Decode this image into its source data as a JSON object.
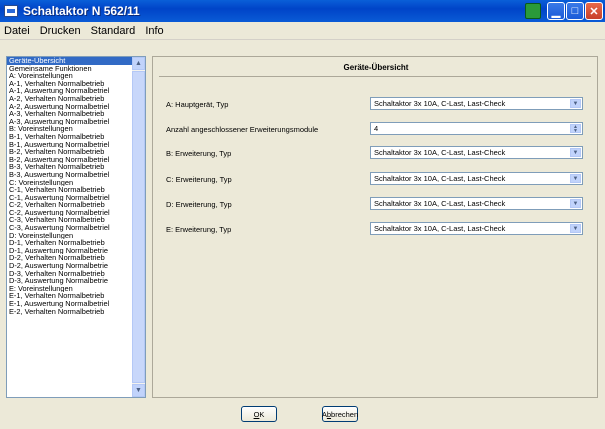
{
  "window": {
    "title": "Schaltaktor N 562/11"
  },
  "menu": [
    "Datei",
    "Drucken",
    "Standard",
    "Info"
  ],
  "nav": {
    "items": [
      "Geräte-Übersicht",
      "Gemeinsame Funktionen",
      "A: Voreinstellungen",
      "A-1, Verhalten Normalbetrieb",
      "A-1, Auswertung Normalbetriel",
      "A-2, Verhalten Normalbetrieb",
      "A-2, Auswertung Normalbetriel",
      "A-3, Verhalten Normalbetrieb",
      "A-3, Auswertung Normalbetriel",
      "B: Voreinstellungen",
      "B-1, Verhalten Normalbetrieb",
      "B-1, Auswertung Normalbetriel",
      "B-2, Verhalten Normalbetrieb",
      "B-2, Auswertung Normalbetriel",
      "B-3, Verhalten Normalbetrieb",
      "B-3, Auswertung Normalbetriel",
      "C: Voreinstellungen",
      "C-1, Verhalten Normalbetrieb",
      "C-1, Auswertung Normalbetriel",
      "C-2, Verhalten Normalbetrieb",
      "C-2, Auswertung Normalbetriel",
      "C-3, Verhalten Normalbetrieb",
      "C-3, Auswertung Normalbetriel",
      "D: Voreinstellungen",
      "D-1, Verhalten Normalbetrieb",
      "D-1, Auswertung Normalbetrie",
      "D-2, Verhalten Normalbetrieb",
      "D-2, Auswertung Normalbetrie",
      "D-3, Verhalten Normalbetrieb",
      "D-3, Auswertung Normalbetrie",
      "E: Voreinstellungen",
      "E-1, Verhalten Normalbetrieb",
      "E-1, Auswertung Normalbetriel",
      "E-2, Verhalten Normalbetrieb"
    ],
    "selected_index": 0
  },
  "panel": {
    "title": "Geräte-Übersicht",
    "rows": [
      {
        "label": "A: Hauptgerät, Typ",
        "control": "combo",
        "value": "Schaltaktor 3x 10A, C-Last, Last-Check"
      },
      {
        "label": "Anzahl angeschlossener Erweiterungsmodule",
        "control": "spin",
        "value": "4"
      },
      {
        "label": "B: Erweiterung, Typ",
        "control": "combo",
        "value": "Schaltaktor 3x 10A, C-Last, Last-Check"
      },
      {
        "label": "C: Erweiterung, Typ",
        "control": "combo",
        "value": "Schaltaktor 3x 10A, C-Last, Last-Check"
      },
      {
        "label": "D: Erweiterung, Typ",
        "control": "combo",
        "value": "Schaltaktor 3x 10A, C-Last, Last-Check"
      },
      {
        "label": "E: Erweiterung, Typ",
        "control": "combo",
        "value": "Schaltaktor 3x 10A, C-Last, Last-Check"
      }
    ]
  },
  "buttons": {
    "ok": {
      "prefix": "",
      "mnemonic": "O",
      "suffix": "K"
    },
    "cancel": {
      "prefix": "A",
      "mnemonic": "b",
      "suffix": "brechen"
    }
  }
}
